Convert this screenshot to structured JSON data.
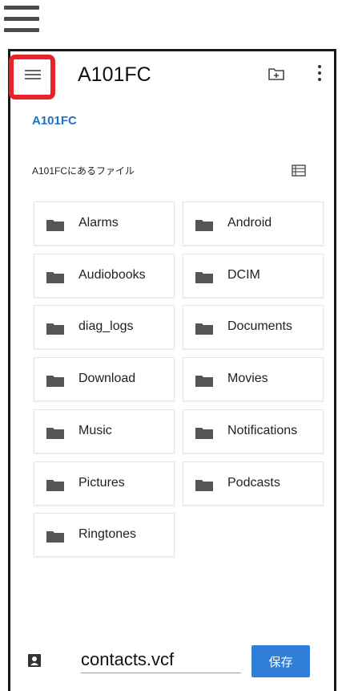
{
  "app": {
    "title": "A101FC"
  },
  "breadcrumb": "A101FC",
  "section_title": "A101FCにあるファイル",
  "folders": [
    "Alarms",
    "Android",
    "Audiobooks",
    "DCIM",
    "diag_logs",
    "Documents",
    "Download",
    "Movies",
    "Music",
    "Notifications",
    "Pictures",
    "Podcasts",
    "Ringtones"
  ],
  "bottom": {
    "filename": "contacts.vcf",
    "save_label": "保存"
  },
  "icons": {
    "outer": "hamburger-icon",
    "nav": "menu-icon",
    "new_folder": "new-folder-icon",
    "more": "more-vert-icon",
    "list_view": "list-view-icon",
    "folder": "folder-icon",
    "contact": "contact-icon"
  },
  "colors": {
    "accent": "#2f7ed8",
    "link": "#1a73c8",
    "highlight": "#e6242a"
  }
}
